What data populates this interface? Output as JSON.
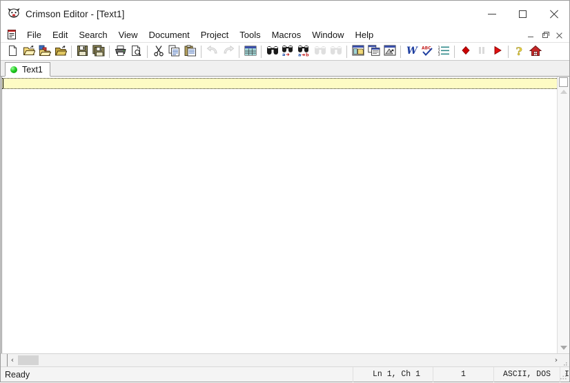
{
  "window": {
    "title": "Crimson Editor - [Text1]",
    "app_icon": "crimson-editor-icon",
    "controls": {
      "minimize": "minimize",
      "maximize": "maximize",
      "close": "close"
    }
  },
  "mdi": {
    "doc_icon": "document-icon",
    "controls": {
      "minimize": "minimize-document",
      "restore": "restore-document",
      "close": "close-document"
    }
  },
  "menubar": {
    "items": [
      {
        "label": "File"
      },
      {
        "label": "Edit"
      },
      {
        "label": "Search"
      },
      {
        "label": "View"
      },
      {
        "label": "Document"
      },
      {
        "label": "Project"
      },
      {
        "label": "Tools"
      },
      {
        "label": "Macros"
      },
      {
        "label": "Window"
      },
      {
        "label": "Help"
      }
    ]
  },
  "toolbar": {
    "groups": [
      {
        "buttons": [
          {
            "name": "new-file-icon",
            "title": "New",
            "enabled": true
          },
          {
            "name": "open-file-icon",
            "title": "Open",
            "enabled": true
          },
          {
            "name": "open-recent-icon",
            "title": "Open Recent",
            "enabled": true
          },
          {
            "name": "open-project-icon",
            "title": "Open Project",
            "enabled": true
          }
        ]
      },
      {
        "buttons": [
          {
            "name": "save-icon",
            "title": "Save",
            "enabled": true
          },
          {
            "name": "save-all-icon",
            "title": "Save All",
            "enabled": true
          }
        ]
      },
      {
        "buttons": [
          {
            "name": "print-icon",
            "title": "Print",
            "enabled": true
          },
          {
            "name": "print-preview-icon",
            "title": "Print Preview",
            "enabled": true
          }
        ]
      },
      {
        "buttons": [
          {
            "name": "cut-icon",
            "title": "Cut",
            "enabled": true
          },
          {
            "name": "copy-icon",
            "title": "Copy",
            "enabled": true
          },
          {
            "name": "paste-icon",
            "title": "Paste",
            "enabled": true
          }
        ]
      },
      {
        "buttons": [
          {
            "name": "undo-icon",
            "title": "Undo",
            "enabled": false
          },
          {
            "name": "redo-icon",
            "title": "Redo",
            "enabled": false
          }
        ]
      },
      {
        "buttons": [
          {
            "name": "column-mode-icon",
            "title": "Column Mode",
            "enabled": true
          }
        ]
      },
      {
        "buttons": [
          {
            "name": "find-icon",
            "title": "Find",
            "enabled": true
          },
          {
            "name": "replace-icon",
            "title": "Replace",
            "enabled": true
          },
          {
            "name": "find-in-files-icon",
            "title": "Find in Files",
            "enabled": true
          },
          {
            "name": "find-previous-icon",
            "title": "Find Previous",
            "enabled": false
          },
          {
            "name": "find-next-icon",
            "title": "Find Next",
            "enabled": false
          }
        ]
      },
      {
        "buttons": [
          {
            "name": "new-window-icon",
            "title": "New Window",
            "enabled": true
          },
          {
            "name": "tile-windows-icon",
            "title": "Tile Windows",
            "enabled": true
          },
          {
            "name": "browser-preview-icon",
            "title": "Browser Preview",
            "enabled": true
          }
        ]
      },
      {
        "buttons": [
          {
            "name": "word-wrap-icon",
            "title": "Word Wrap",
            "enabled": true
          },
          {
            "name": "spell-check-icon",
            "title": "Spell Check",
            "enabled": true
          },
          {
            "name": "line-numbers-icon",
            "title": "Line Numbers",
            "enabled": true
          }
        ]
      },
      {
        "buttons": [
          {
            "name": "record-macro-icon",
            "title": "Record Macro",
            "enabled": true
          },
          {
            "name": "pause-macro-icon",
            "title": "Pause Macro",
            "enabled": false
          },
          {
            "name": "play-macro-icon",
            "title": "Play Macro",
            "enabled": true
          }
        ]
      },
      {
        "buttons": [
          {
            "name": "help-icon",
            "title": "Help",
            "enabled": true
          },
          {
            "name": "home-icon",
            "title": "Home",
            "enabled": true
          }
        ]
      }
    ]
  },
  "tabs": [
    {
      "label": "Text1",
      "icon": "green-dot-icon",
      "active": true
    }
  ],
  "editor": {
    "content": "",
    "current_line_highlight": "#fdfbc4",
    "background": "#ffffff"
  },
  "scrollbars": {
    "vertical": {
      "up_arrow": "scroll-up-arrow",
      "down_arrow": "scroll-down-arrow"
    },
    "horizontal": {
      "left_arrow": "‹",
      "right_arrow": "›"
    }
  },
  "statusbar": {
    "message": "Ready",
    "position": "Ln 1,  Ch 1",
    "selection": "1",
    "encoding": "ASCII, DOS",
    "insert_mode": "I"
  },
  "colors": {
    "window_bg": "#ffffff",
    "toolbar_bg": "#ffffff",
    "tabstrip_bg": "#f0f0f0",
    "statusbar_bg": "#f4f4f4",
    "current_line": "#fdfbc4",
    "tab_dot_green": "#22cc22",
    "macro_record_red": "#cc0000"
  }
}
